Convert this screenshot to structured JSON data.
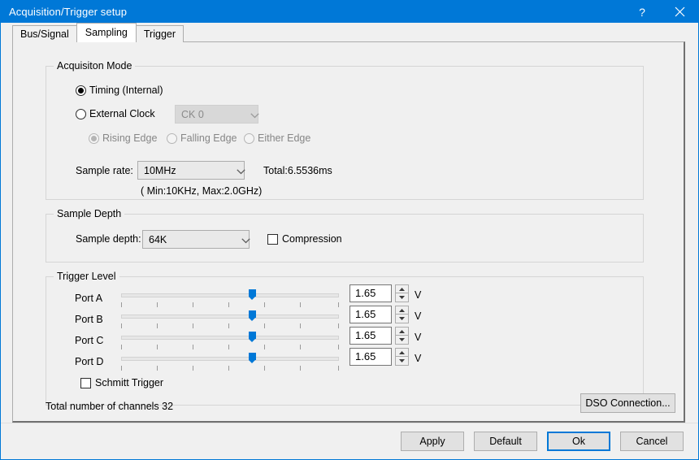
{
  "window": {
    "title": "Acquisition/Trigger setup",
    "help_icon": "?",
    "close_icon": "close-icon",
    "accent_color": "#0078d7",
    "background_color": "#f0f0f0"
  },
  "tabs": [
    {
      "label": "Bus/Signal",
      "selected": false
    },
    {
      "label": "Sampling",
      "selected": true
    },
    {
      "label": "Trigger",
      "selected": false
    }
  ],
  "acquisition_mode": {
    "title": "Acquisiton Mode",
    "mode_options": [
      {
        "label": "Timing (Internal)",
        "selected": true
      },
      {
        "label": "External Clock",
        "selected": false
      }
    ],
    "clock_select": {
      "value": "CK 0",
      "disabled": true
    },
    "edge_options": [
      {
        "label": "Rising Edge",
        "selected": true,
        "disabled": true
      },
      {
        "label": "Falling Edge",
        "selected": false,
        "disabled": true
      },
      {
        "label": "Either Edge",
        "selected": false,
        "disabled": true
      }
    ],
    "sample_rate_label": "Sample rate:",
    "sample_rate_value": "10MHz",
    "total_text": "Total:6.5536ms",
    "range_text": "( Min:10KHz, Max:2.0GHz)"
  },
  "sample_depth": {
    "title": "Sample Depth",
    "depth_label": "Sample depth:",
    "depth_value": "64K",
    "compression_label": "Compression",
    "compression_checked": false
  },
  "trigger_level": {
    "title": "Trigger Level",
    "unit": "V",
    "slider_percent": 60,
    "tick_count": 7,
    "ports": [
      {
        "label": "Port A",
        "value": "1.65"
      },
      {
        "label": "Port B",
        "value": "1.65"
      },
      {
        "label": "Port C",
        "value": "1.65"
      },
      {
        "label": "Port D",
        "value": "1.65"
      }
    ],
    "schmitt_label": "Schmitt Trigger",
    "schmitt_checked": false
  },
  "status": {
    "channels_text": "Total number of channels 32",
    "dso_button": "DSO Connection..."
  },
  "footer_buttons": [
    {
      "label": "Apply",
      "focused": false
    },
    {
      "label": "Default",
      "focused": false
    },
    {
      "label": "Ok",
      "focused": true
    },
    {
      "label": "Cancel",
      "focused": false
    }
  ]
}
